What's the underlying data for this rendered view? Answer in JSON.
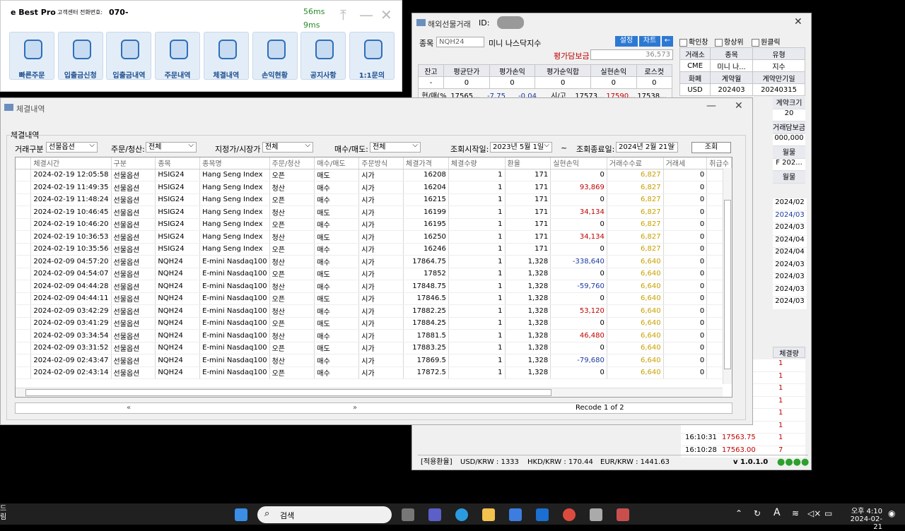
{
  "launcher": {
    "brand": "e Best Pro",
    "cs_label": "고객센터 전화번호:",
    "cs_number": "070-",
    "ping1": "56ms",
    "ping2": "9ms",
    "buttons": [
      "빠른주문",
      "입출금신청",
      "입출금내역",
      "주문내역",
      "체결내역",
      "손익현황",
      "공지사항",
      "1:1문의"
    ]
  },
  "trade": {
    "title": "해외선물거래",
    "id_label": "ID:",
    "symbol_label": "종목",
    "symbol": "NQH24",
    "symbol_name": "미니 나스닥지수",
    "btn_settings": "설정",
    "btn_chart": "차트",
    "btn_arrow": "←",
    "eval_label": "평가담보금",
    "eval_value": "36,573",
    "chk1": "확인창",
    "chk2": "항상위",
    "chk3": "원클릭",
    "pos_headers": [
      "잔고",
      "평균단가",
      "평가손익",
      "평가순익합",
      "실현손익",
      "로스컷"
    ],
    "pos_values": [
      "-",
      "0",
      "0",
      "0",
      "0",
      "0"
    ],
    "row2": [
      "현/매(%",
      "17565...",
      "-7.75",
      "-0.04",
      "시/고",
      "17573...",
      "17590...",
      "17538..."
    ],
    "info": [
      [
        "거래소",
        "종목",
        "유형"
      ],
      [
        "CME",
        "미니 나...",
        "지수"
      ],
      [
        "화폐",
        "계약월",
        "계약만기일"
      ],
      [
        "USD",
        "202403",
        "20240315"
      ]
    ],
    "right_labels": [
      "계약크기",
      "20",
      "거래담보금",
      "000,000",
      "월물",
      "F 202...",
      "월물"
    ],
    "months": [
      "2024/02",
      "2024/03",
      "2024/03",
      "2024/04",
      "2024/04",
      "2024/03",
      "2024/03",
      "2024/03",
      "2024/03"
    ],
    "ticks_header": "체결량",
    "ticks": [
      [
        "",
        "1"
      ],
      [
        "",
        "1"
      ],
      [
        "",
        "1"
      ],
      [
        "",
        "1"
      ],
      [
        "",
        "1"
      ],
      [
        "",
        "1"
      ],
      [
        "16:10:31",
        "17563.75",
        "1"
      ],
      [
        "16:10:28",
        "17563.00",
        "7"
      ]
    ],
    "status_rate": "[적용환율]",
    "usd": "USD/KRW : 1333",
    "hkd": "HKD/KRW : 170.44",
    "eur": "EUR/KRW : 1441.63",
    "version": "v 1.0.1.0"
  },
  "detail": {
    "title": "체결내역",
    "group": "체결내역",
    "f_type_label": "거래구분",
    "f_type": "선물옵션",
    "f_oc_label": "주문/청산:",
    "f_oc": "전체",
    "f_lim_label": "지정가/시장가",
    "f_lim": "전체",
    "f_bs_label": "매수/매도:",
    "f_bs": "전체",
    "start_label": "조회시작일:",
    "start": "2023년  5월  1일",
    "tilde": "~",
    "end_label": "조회종료일:",
    "end": "2024년  2월 21일",
    "query": "조회",
    "headers": [
      "체결시간",
      "구분",
      "종목",
      "종목명",
      "주문/청산",
      "매수/매도",
      "주문방식",
      "체결가격",
      "체결수량",
      "환율",
      "실현손익",
      "거래수수료",
      "거래세",
      "취급수"
    ],
    "rows": [
      [
        "2024-02-19  12:05:58",
        "선물옵션",
        "HSIG24",
        "Hang Seng Index",
        "오픈",
        "매도",
        "시가",
        "16208",
        "1",
        "171",
        "0",
        "6,827",
        "0"
      ],
      [
        "2024-02-19  11:49:35",
        "선물옵션",
        "HSIG24",
        "Hang Seng Index",
        "청산",
        "매수",
        "시가",
        "16204",
        "1",
        "171",
        "93,869",
        "6,827",
        "0"
      ],
      [
        "2024-02-19  11:48:24",
        "선물옵션",
        "HSIG24",
        "Hang Seng Index",
        "오픈",
        "매수",
        "시가",
        "16215",
        "1",
        "171",
        "0",
        "6,827",
        "0"
      ],
      [
        "2024-02-19  10:46:45",
        "선물옵션",
        "HSIG24",
        "Hang Seng Index",
        "청산",
        "매도",
        "시가",
        "16199",
        "1",
        "171",
        "34,134",
        "6,827",
        "0"
      ],
      [
        "2024-02-19  10:46:20",
        "선물옵션",
        "HSIG24",
        "Hang Seng Index",
        "오픈",
        "매수",
        "시가",
        "16195",
        "1",
        "171",
        "0",
        "6,827",
        "0"
      ],
      [
        "2024-02-19  10:36:53",
        "선물옵션",
        "HSIG24",
        "Hang Seng Index",
        "청산",
        "매도",
        "시가",
        "16250",
        "1",
        "171",
        "34,134",
        "6,827",
        "0"
      ],
      [
        "2024-02-19  10:35:56",
        "선물옵션",
        "HSIG24",
        "Hang Seng Index",
        "오픈",
        "매수",
        "시가",
        "16246",
        "1",
        "171",
        "0",
        "6,827",
        "0"
      ],
      [
        "2024-02-09  04:57:20",
        "선물옵션",
        "NQH24",
        "E-mini Nasdaq100",
        "청산",
        "매수",
        "시가",
        "17864.75",
        "1",
        "1,328",
        "-338,640",
        "6,640",
        "0"
      ],
      [
        "2024-02-09  04:54:07",
        "선물옵션",
        "NQH24",
        "E-mini Nasdaq100",
        "오픈",
        "매도",
        "시가",
        "17852",
        "1",
        "1,328",
        "0",
        "6,640",
        "0"
      ],
      [
        "2024-02-09  04:44:28",
        "선물옵션",
        "NQH24",
        "E-mini Nasdaq100",
        "청산",
        "매수",
        "시가",
        "17848.75",
        "1",
        "1,328",
        "-59,760",
        "6,640",
        "0"
      ],
      [
        "2024-02-09  04:44:11",
        "선물옵션",
        "NQH24",
        "E-mini Nasdaq100",
        "오픈",
        "매도",
        "시가",
        "17846.5",
        "1",
        "1,328",
        "0",
        "6,640",
        "0"
      ],
      [
        "2024-02-09  03:42:29",
        "선물옵션",
        "NQH24",
        "E-mini Nasdaq100",
        "청산",
        "매수",
        "시가",
        "17882.25",
        "1",
        "1,328",
        "53,120",
        "6,640",
        "0"
      ],
      [
        "2024-02-09  03:41:29",
        "선물옵션",
        "NQH24",
        "E-mini Nasdaq100",
        "오픈",
        "매도",
        "시가",
        "17884.25",
        "1",
        "1,328",
        "0",
        "6,640",
        "0"
      ],
      [
        "2024-02-09  03:34:54",
        "선물옵션",
        "NQH24",
        "E-mini Nasdaq100",
        "청산",
        "매수",
        "시가",
        "17881.5",
        "1",
        "1,328",
        "46,480",
        "6,640",
        "0"
      ],
      [
        "2024-02-09  03:31:52",
        "선물옵션",
        "NQH24",
        "E-mini Nasdaq100",
        "오픈",
        "매도",
        "시가",
        "17883.25",
        "1",
        "1,328",
        "0",
        "6,640",
        "0"
      ],
      [
        "2024-02-09  02:43:47",
        "선물옵션",
        "NQH24",
        "E-mini Nasdaq100",
        "청산",
        "매수",
        "시가",
        "17869.5",
        "1",
        "1,328",
        "-79,680",
        "6,640",
        "0"
      ],
      [
        "2024-02-09  02:43:14",
        "선물옵션",
        "NQH24",
        "E-mini Nasdaq100",
        "오픈",
        "매수",
        "시가",
        "17872.5",
        "1",
        "1,328",
        "0",
        "6,640",
        "0"
      ]
    ],
    "pager_prev": "«",
    "pager_next": "»",
    "record": "Recode 1 of 2"
  },
  "taskbar": {
    "search": "검색",
    "time": "오후 4:10",
    "date": "2024-02-21",
    "left_fragment1": "드",
    "left_fragment2": "림"
  }
}
